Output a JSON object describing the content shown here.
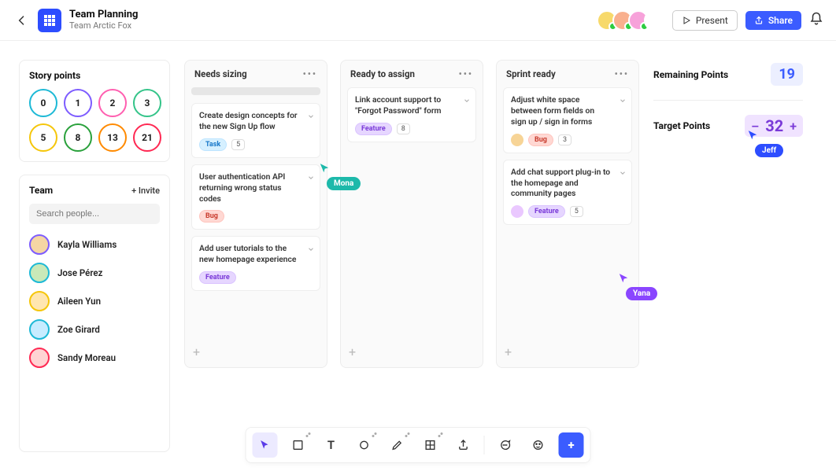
{
  "header": {
    "title": "Team Planning",
    "subtitle": "Team Arctic Fox",
    "present_label": "Present",
    "share_label": "Share"
  },
  "collaborator_colors": [
    "#f7d96b",
    "#f9b08e",
    "#f7a2da",
    "#ffffff"
  ],
  "story_points": {
    "title": "Story points",
    "chips": [
      {
        "label": "0",
        "color": "#1db9d6"
      },
      {
        "label": "1",
        "color": "#7d5cff"
      },
      {
        "label": "2",
        "color": "#ff5fb0"
      },
      {
        "label": "3",
        "color": "#34c489"
      },
      {
        "label": "5",
        "color": "#f5c60a"
      },
      {
        "label": "8",
        "color": "#2aa13c"
      },
      {
        "label": "13",
        "color": "#ff8a00"
      },
      {
        "label": "21",
        "color": "#ff2953"
      }
    ]
  },
  "team": {
    "title": "Team",
    "invite_label": "+ Invite",
    "search_placeholder": "Search people...",
    "members": [
      {
        "name": "Kayla Williams",
        "ring": "#7d5cff",
        "bg": "#f5d6a4"
      },
      {
        "name": "Jose Pérez",
        "ring": "#1db9d6",
        "bg": "#c9e9b8"
      },
      {
        "name": "Aileen Yun",
        "ring": "#f5c60a",
        "bg": "#ffe6b0"
      },
      {
        "name": "Zoe Girard",
        "ring": "#1db9d6",
        "bg": "#c7ecff"
      },
      {
        "name": "Sandy Moreau",
        "ring": "#ff2953",
        "bg": "#ffd3d3"
      }
    ]
  },
  "columns": [
    {
      "title": "Needs sizing",
      "has_placeholder": true,
      "cards": [
        {
          "title": "Create design concepts for the new Sign Up flow",
          "tag": "task",
          "tag_label": "Task",
          "points": "5"
        },
        {
          "title": "User authentication API returning wrong status codes",
          "tag": "bug",
          "tag_label": "Bug"
        },
        {
          "title": "Add user tutorials to the new homepage experience",
          "tag": "feature",
          "tag_label": "Feature"
        }
      ]
    },
    {
      "title": "Ready to assign",
      "cards": [
        {
          "title": "Link account support to \"Forgot Password\" form",
          "tag": "feature",
          "tag_label": "Feature",
          "points": "8"
        }
      ]
    },
    {
      "title": "Sprint ready",
      "cards": [
        {
          "title": "Adjust white space between form fields on sign up / sign in forms",
          "tag": "bug",
          "tag_label": "Bug",
          "points": "3",
          "avatar": "#f7d496"
        },
        {
          "title": "Add chat support plug-in to the homepage and community pages",
          "tag": "feature",
          "tag_label": "Feature",
          "points": "5",
          "avatar": "#eac8ff"
        }
      ]
    }
  ],
  "stats": {
    "remaining_label": "Remaining Points",
    "remaining_value": "19",
    "target_label": "Target Points",
    "target_value": "32",
    "minus": "–",
    "plus": "+"
  },
  "cursors": {
    "mona": {
      "name": "Mona",
      "color": "#1db9aa"
    },
    "yana": {
      "name": "Yana",
      "color": "#8a46ff"
    },
    "jeff": {
      "name": "Jeff",
      "color": "#2d4dff"
    }
  }
}
